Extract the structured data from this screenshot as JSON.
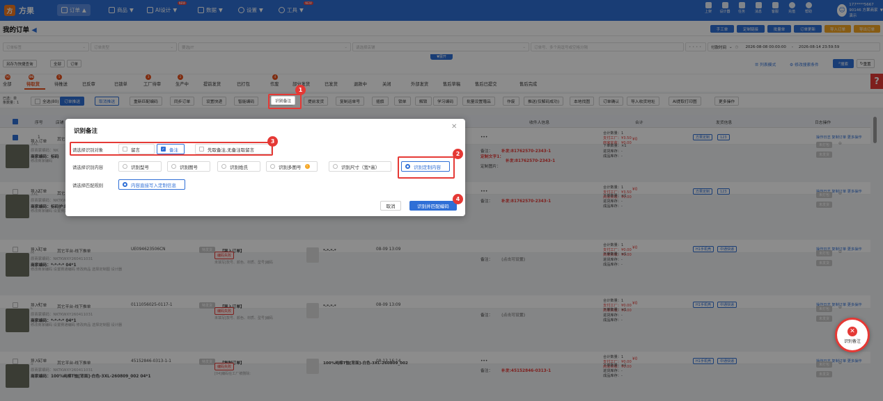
{
  "app": {
    "name": "方果",
    "logo_char": "方"
  },
  "nav": {
    "items": [
      {
        "label": "订单"
      },
      {
        "label": "商品"
      },
      {
        "label": "AI设计"
      },
      {
        "label": "数据"
      },
      {
        "label": "设置"
      },
      {
        "label": "工具"
      }
    ],
    "new_tag": "NEW",
    "right_icons": [
      "上架",
      "设计器",
      "任务",
      "消息",
      "客服",
      "充值",
      "帮助"
    ],
    "user": {
      "line1": "177****5667",
      "line2": "90146 方果商家演示",
      "avatar": "☺"
    }
  },
  "header": {
    "title": "我的订单",
    "buttons": [
      {
        "label": "手工单",
        "color": "#2f6fd6"
      },
      {
        "label": "定制链接",
        "color": "#2f6fd6"
      },
      {
        "label": "批量单",
        "color": "#2f6fd6"
      },
      {
        "label": "订单更新",
        "color": "#2f6fd6"
      },
      {
        "label": "导入订单",
        "color": "#f5a623"
      },
      {
        "label": "导出订单",
        "color": "#f5a623"
      }
    ]
  },
  "filters": {
    "order_tag": "订单标签",
    "order_type": "订单类型",
    "shop": "要选JIT",
    "source": "请选择店铺",
    "search": "订单号、多个用逗号或空格分隔",
    "dots": "• • • •",
    "time_label": "付款时间",
    "date_from": "2026-08-08 00:00:00",
    "date_sep": "-",
    "date_to": "2026-08-14 23:59:59",
    "expand": "▼展开",
    "save_query": "另存为快捷查询",
    "all": "全部",
    "order": "订单",
    "list_mode": "列表模式",
    "modify_search": "修改搜索条件",
    "search_btn": "搜索",
    "reset": "重置"
  },
  "status_tabs": [
    {
      "label": "全部",
      "badge": "96"
    },
    {
      "label": "待取货",
      "badge": "86"
    },
    {
      "label": "待推送",
      "badge": "5"
    },
    {
      "label": "已反审",
      "badge": ""
    },
    {
      "label": "已锁单",
      "badge": ""
    },
    {
      "label": "工厂待审",
      "badge": "3"
    },
    {
      "label": "生产中",
      "badge": "2"
    },
    {
      "label": "提前发货",
      "badge": ""
    },
    {
      "label": "已打包",
      "badge": ""
    },
    {
      "label": "作废",
      "badge": "4"
    },
    {
      "label": "部分发货",
      "badge": ""
    },
    {
      "label": "已发货",
      "badge": ""
    },
    {
      "label": "退款中",
      "badge": ""
    },
    {
      "label": "关闭",
      "badge": ""
    },
    {
      "label": "外部发货",
      "badge": ""
    },
    {
      "label": "售后草稿",
      "badge": ""
    },
    {
      "label": "售后已提交",
      "badge": ""
    },
    {
      "label": "售后完成",
      "badge": ""
    }
  ],
  "action_bar": {
    "selected_label_1": "已选：单",
    "selected_label_2": "条数量：1",
    "select_all": "全选(80)",
    "buttons": [
      "订单推送",
      "取消推送",
      "重新匹配编码",
      "同步订单",
      "设置快递",
      "智能编码",
      "识别备注",
      "提前发货",
      "复制运单号",
      "插旗",
      "锁单",
      "解锁",
      "学习编码",
      "批量设置赠品",
      "作废",
      "推送(仅解码成功)",
      "本地找图",
      "订单确认",
      "导入收货地址",
      "AI提取打印图",
      "更多操作"
    ]
  },
  "table": {
    "headers": [
      "序号",
      "店铺",
      "收件人信息",
      "合计",
      "发货信息",
      "日志操作"
    ],
    "rows": [
      {
        "no": "1",
        "platform": "其它",
        "type": "导入订单",
        "size": "3XL",
        "merchant_code": "原商家编码：NK",
        "code2": "商家编码：标码",
        "edit": "修改商家编码",
        "dots": "•••",
        "remark_label": "备注：",
        "remark": "补发:81762570-2343-1",
        "custom_text_label": "定制文字1：",
        "custom_text": "补发:81762570-2343-1",
        "custom_img_label": "定制图片：",
        "total": [
          "合计数量：1",
          "支付工厂：¥3.50",
          "商家实收：¥0.00"
        ],
        "price": "¥0",
        "order_qty": "下单数量：×1",
        "stock": [
          "进货库存：-",
          "成品库存：-"
        ],
        "ship": [
          "方果定制",
          "123"
        ],
        "ops": "操作日志 复制订单 更多操作",
        "btn1": "未打包",
        "btn2": "未发货"
      },
      {
        "no": "2",
        "platform": "其它",
        "type": "导入订单",
        "size": "3XL",
        "merchant_code": "原商家编码：NKTKWXY260408013",
        "code2": "商家编码：标码护士服-纯黑-2XL-798796916",
        "edit": "修改商家编码  设置赛通编码  修改商品  选择定制图  设计器",
        "status": "编码成功",
        "product_title": "标码护士服-纯黑-2XL-798796916",
        "product_price": "¥0.00",
        "dots": "•••",
        "remark_label": "备注：",
        "remark": "补发:81762570-2343-1",
        "total": [
          "合计数量：1",
          "支付工厂：¥3.50",
          "商家实收：¥0.00"
        ],
        "price": "¥0",
        "order_qty": "下单数量：×1",
        "stock": [
          "进货库存：-",
          "成品库存：-"
        ],
        "ship": [
          "方果定制",
          "123"
        ],
        "ops": "操作日志 复制订单 更多操作",
        "btn1": "未打包",
        "btn2": "未发货"
      },
      {
        "no": "3",
        "platform": "其它平台-线下推单",
        "order_no": "UE094623506CN",
        "tag": "特发货",
        "source_tag": "【导入订单】",
        "date": "08-09 13:09",
        "type": "导入订单",
        "size": "M",
        "merchant_code": "原商家编码：NKTKWXY260411031",
        "code2": "商家编码：*-*-*-* 04*1",
        "edit": "修改商家编码  设置赛通编码  修改商品  选择定制图  设计器",
        "status": "编码失败",
        "status_note": "未填写[款号、颜色、材质、型号]编码",
        "product_title": "*-*-*-*",
        "dots": "",
        "remark_label": "备注：",
        "remark": "(点击可设置)",
        "total": [
          "合计数量：1",
          "支付工厂：¥0.00",
          "商家实收：¥0.00"
        ],
        "price": "¥0",
        "order_qty": "下单数量：×1",
        "stock": [
          "进货库存：-",
          "成品库存：-"
        ],
        "ship": [
          "H1手机壳",
          "中通快递"
        ],
        "ops": "操作日志 复制订单 更多操作",
        "btn1": "未打包",
        "btn2": "未发货"
      },
      {
        "no": "4",
        "platform": "其它平台-线下推单",
        "order_no": "0111056025-0117-1",
        "tag": "特发货",
        "source_tag": "【导入订单】",
        "date": "08-09 13:09",
        "type": "导入订单",
        "size": "L",
        "merchant_code": "原商家编码：NKTKWXY260411031",
        "code2": "商家编码：*-*-*-* 04*1",
        "edit": "修改商家编码  设置赛通编码  修改商品  选择定制图  设计器",
        "status": "编码失败",
        "status_note": "未填写[款号、颜色、材质、型号]编码",
        "product_title": "*-*-*-*",
        "dots": "",
        "remark_label": "备注：",
        "remark": "(点击可设置)",
        "total": [
          "合计数量：1",
          "支付工厂：¥0.00",
          "商家实收：¥0.00"
        ],
        "price": "¥0",
        "order_qty": "下单数量：×1",
        "stock": [
          "进货库存：-",
          "成品库存：-"
        ],
        "ship": [
          "H1手机壳",
          "中通快递"
        ],
        "ops": "操作日志 复制订单 更多操作",
        "btn1": "未打包",
        "btn2": "未发货"
      },
      {
        "no": "5",
        "platform": "其它平台-线下推单",
        "order_no": "45152846-0313-1-1",
        "tag": "特发货",
        "source_tag": "【复制订单】",
        "date": "08-13 16:14",
        "type": "导入订单",
        "size": "S",
        "merchant_code": "原商家编码：NKTKWXY260411031",
        "code2": "商家编码：100%纯棉T恤[背面]-白色-3XL-260809_002  04*1",
        "status": "编码失败",
        "status_note": "[04]编码在工厂被删除;",
        "product_title": "100%纯棉T恤[背面]-白色-3XL-260809_002",
        "dots": "•••",
        "remark_label": "备注：",
        "remark": "补发:45152846-0313-1",
        "total": [
          "合计数量：1",
          "支付工厂：¥0.00",
          "商家实收：¥0.00"
        ],
        "price": "¥0",
        "order_qty": "下单数量：×1",
        "stock": [
          "进货库存：-",
          "成品库存：-"
        ],
        "ship": [
          "H1手机壳",
          "中通快递"
        ],
        "ops": "操作日志 复制订单 更多操作",
        "btn1": "未打包",
        "btn2": "未发货"
      }
    ]
  },
  "modal": {
    "title": "识别备注",
    "row1_label": "请选择识别对象",
    "row1_options": [
      {
        "label": "留言",
        "checked": false
      },
      {
        "label": "备注",
        "checked": true
      },
      {
        "label": "先取备注,无备注取留言",
        "checked": false
      }
    ],
    "row2_label": "请选择识别内容",
    "row2_options": [
      {
        "label": "识别型号",
        "selected": false
      },
      {
        "label": "识别图号",
        "selected": false
      },
      {
        "label": "识别姓氏",
        "selected": false
      },
      {
        "label": "识别多图号",
        "selected": false
      },
      {
        "label": "识别尺寸（宽*高）",
        "selected": false
      },
      {
        "label": "识别定制内容",
        "selected": true
      }
    ],
    "warn": "!",
    "row3_label": "请选择匹配规则",
    "row3_option": "内容直接写入定制信息",
    "cancel": "取消",
    "confirm": "识别并匹配编码",
    "close": "✕"
  },
  "markers": [
    "1",
    "2",
    "3",
    "4"
  ],
  "float_btn": {
    "label": "识别备注",
    "icon": "✕"
  },
  "help": "?",
  "colors": {
    "primary": "#2f6fd6",
    "accent": "#e8501c",
    "annot": "#e53935",
    "orange": "#f5a623"
  }
}
